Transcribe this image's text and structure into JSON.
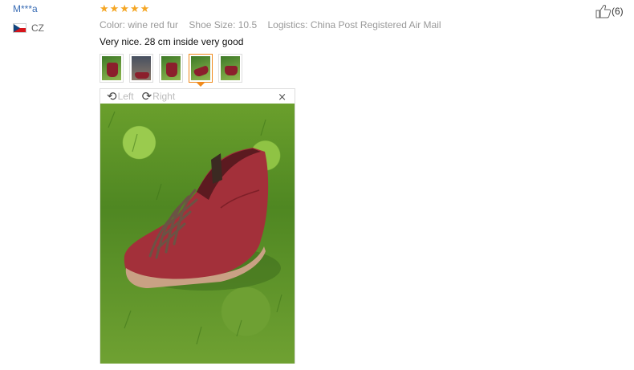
{
  "user": {
    "name": "M***a",
    "country": "CZ"
  },
  "review": {
    "rating": 5,
    "rating_max": 5,
    "color_text": "Color: wine red fur",
    "size_text": "Shoe Size: 10.5",
    "logistics_text": "Logistics: China Post Registered Air Mail",
    "text": "Very nice. 28 cm inside very good"
  },
  "thumbnails": {
    "count": 5,
    "active_index": 3
  },
  "viewer": {
    "rotate_left_label": "Left",
    "rotate_right_label": "Right",
    "close_label": "×"
  },
  "likes": {
    "count_label": "(6)"
  },
  "colors": {
    "accent_orange": "#f08a1c",
    "star": "#f5a623",
    "link_blue": "#3a6db5",
    "shoe": "#8b1f2c"
  },
  "icons": {
    "rotate_left": "rotate-left-icon",
    "rotate_right": "rotate-right-icon",
    "close": "close-icon",
    "thumbs_up": "thumbs-up-icon",
    "flag": "czech-flag-icon"
  }
}
